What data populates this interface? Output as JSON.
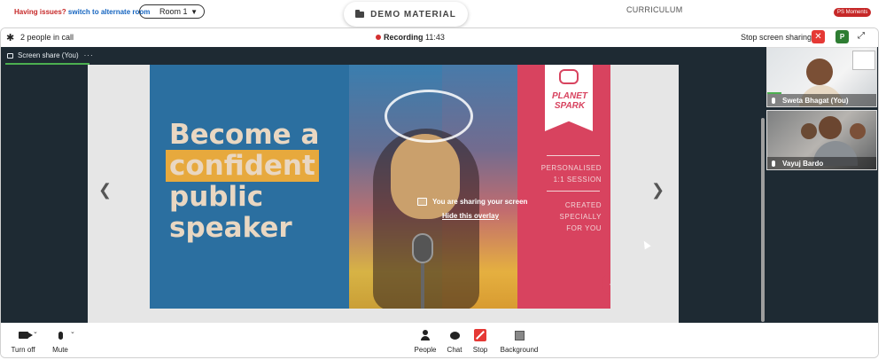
{
  "topbar": {
    "issues_text": "Having issues?",
    "alt_room_link": "switch to alternate room",
    "room_select": "Room 1",
    "demo_tab": "DEMO MATERIAL",
    "curriculum_tab": "CURRICULUM",
    "ps_moments": "PS Moments"
  },
  "call_header": {
    "people_count": "2 people in call",
    "recording_label": "Recording",
    "recording_time": "11:43",
    "stop_share": "Stop screen sharing",
    "p_badge": "P"
  },
  "share": {
    "tab_label": "Screen share (You)",
    "tab_more": "···",
    "overlay_text": "You are sharing your screen",
    "overlay_link": "Hide this overlay"
  },
  "poster": {
    "line1": "Become a",
    "line2": "confident",
    "line3": "public",
    "line4": "speaker",
    "brand_line1": "PLANET",
    "brand_line2": "SPARK",
    "side1_line1": "PERSONALISED",
    "side1_line2": "1:1 SESSION",
    "side2_line1": "CREATED SPECIALLY",
    "side2_line2": "FOR YOU",
    "colors": {
      "blue": "#2b6fa0",
      "pink": "#d8435f",
      "highlight": "#e7a93d"
    }
  },
  "participants": [
    {
      "name": "Sweta Bhagat (You)"
    },
    {
      "name": "Vayuj Bardo"
    }
  ],
  "toolbar": {
    "turn_off": "Turn off",
    "mute": "Mute",
    "people": "People",
    "chat": "Chat",
    "stop": "Stop",
    "background": "Background"
  }
}
